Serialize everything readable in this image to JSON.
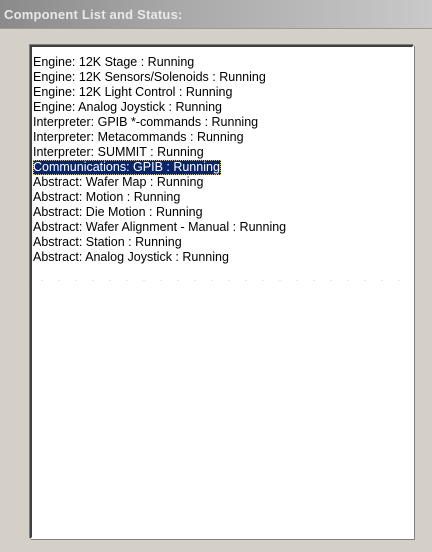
{
  "panel": {
    "title": "Component List and Status:"
  },
  "components": {
    "selected_index": 7,
    "items": [
      {
        "label": "Engine: 12K Stage : Running"
      },
      {
        "label": "Engine: 12K Sensors/Solenoids : Running"
      },
      {
        "label": "Engine: 12K Light Control : Running"
      },
      {
        "label": "Engine: Analog Joystick : Running"
      },
      {
        "label": "Interpreter: GPIB *-commands : Running"
      },
      {
        "label": "Interpreter: Metacommands : Running"
      },
      {
        "label": "Interpreter: SUMMIT : Running"
      },
      {
        "label": "Communications: GPIB : Running"
      },
      {
        "label": "Abstract: Wafer Map : Running"
      },
      {
        "label": "Abstract: Motion : Running"
      },
      {
        "label": "Abstract: Die Motion : Running"
      },
      {
        "label": "Abstract: Wafer Alignment - Manual : Running"
      },
      {
        "label": "Abstract: Station : Running"
      },
      {
        "label": "Abstract: Analog Joystick : Running"
      }
    ]
  },
  "colors": {
    "selection_bg": "#0a246a",
    "selection_fg": "#ffffff",
    "panel_bg": "#d4d0c8"
  }
}
